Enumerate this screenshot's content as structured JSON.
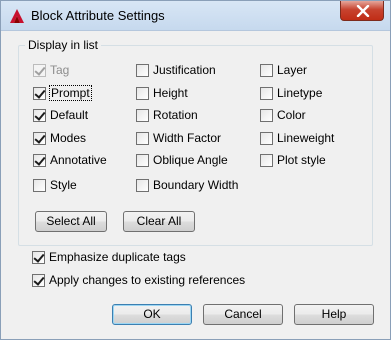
{
  "window": {
    "title": "Block Attribute Settings",
    "close_icon": "close-icon",
    "app_icon": "autocad-logo-icon"
  },
  "display_group": {
    "legend": "Display in list",
    "columns": [
      [
        {
          "label": "Tag",
          "checked": true,
          "disabled": true
        },
        {
          "label": "Prompt",
          "checked": true,
          "disabled": false,
          "focused": true
        },
        {
          "label": "Default",
          "checked": true,
          "disabled": false
        },
        {
          "label": "Modes",
          "checked": true,
          "disabled": false
        },
        {
          "label": "Annotative",
          "checked": true,
          "disabled": false
        },
        {
          "label": "Style",
          "checked": false,
          "disabled": false
        }
      ],
      [
        {
          "label": "Justification",
          "checked": false,
          "disabled": false
        },
        {
          "label": "Height",
          "checked": false,
          "disabled": false
        },
        {
          "label": "Rotation",
          "checked": false,
          "disabled": false
        },
        {
          "label": "Width Factor",
          "checked": false,
          "disabled": false
        },
        {
          "label": "Oblique Angle",
          "checked": false,
          "disabled": false
        },
        {
          "label": "Boundary Width",
          "checked": false,
          "disabled": false
        }
      ],
      [
        {
          "label": "Layer",
          "checked": false,
          "disabled": false
        },
        {
          "label": "Linetype",
          "checked": false,
          "disabled": false
        },
        {
          "label": "Color",
          "checked": false,
          "disabled": false
        },
        {
          "label": "Lineweight",
          "checked": false,
          "disabled": false
        },
        {
          "label": "Plot style",
          "checked": false,
          "disabled": false
        }
      ]
    ],
    "select_all_label": "Select All",
    "clear_all_label": "Clear All"
  },
  "options": {
    "emphasize_label": "Emphasize duplicate tags",
    "emphasize_checked": true,
    "apply_label": "Apply changes to existing references",
    "apply_checked": true
  },
  "buttons": {
    "ok_label": "OK",
    "cancel_label": "Cancel",
    "help_label": "Help"
  }
}
